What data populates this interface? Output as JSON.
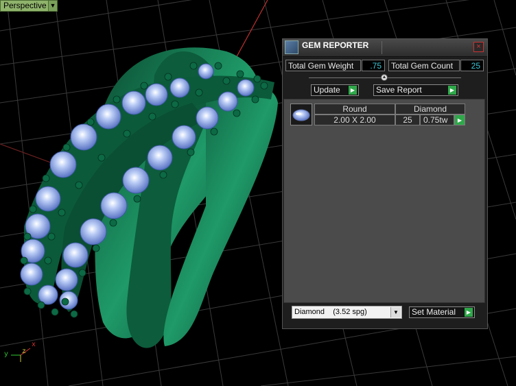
{
  "viewport": {
    "view_label": "Perspective",
    "axis": {
      "x": "x",
      "y": "y",
      "z": "z"
    }
  },
  "gem_reporter": {
    "title": "GEM REPORTER",
    "total_gem_weight_label": "Total Gem Weight",
    "total_gem_weight_value": ".75",
    "total_gem_count_label": "Total Gem Count",
    "total_gem_count_value": "25",
    "update_label": "Update",
    "save_report_label": "Save Report",
    "table": {
      "header_shape": "Round",
      "header_material": "Diamond",
      "size": "2.00 X 2.00",
      "count": "25",
      "weight": "0.75tw"
    },
    "material_select_value": "Diamond    (3.52 spg)",
    "set_material_label": "Set Material"
  },
  "colors": {
    "metal": "#0f6b46",
    "gem": "#8fa9e8",
    "accent_play": "#2fa84a",
    "value_text": "#3cc8d8"
  }
}
